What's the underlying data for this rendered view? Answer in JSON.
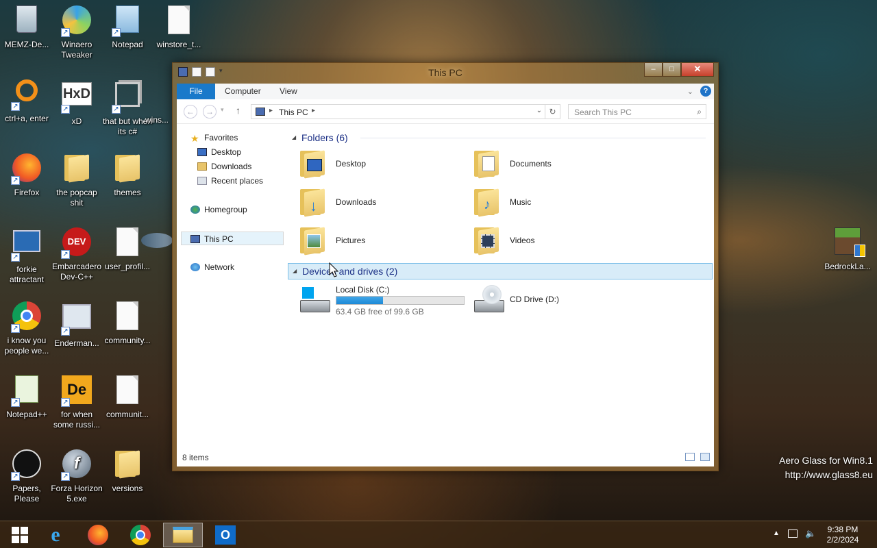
{
  "desktop": {
    "icons": [
      {
        "label": "MEMZ-De..."
      },
      {
        "label": "Winaero Tweaker"
      },
      {
        "label": "Notepad"
      },
      {
        "label": "winstore_t..."
      },
      {
        "label": "ctrl+a, enter"
      },
      {
        "label": "xD"
      },
      {
        "label": "that but when its c#"
      },
      {
        "label": "wins..."
      },
      {
        "label": "Firefox"
      },
      {
        "label": "the popcap shit"
      },
      {
        "label": "themes"
      },
      {
        "label": "forkie attractant"
      },
      {
        "label": "Embarcadero Dev-C++"
      },
      {
        "label": "user_profil..."
      },
      {
        "label": "i know you people we..."
      },
      {
        "label": "Enderman..."
      },
      {
        "label": "community..."
      },
      {
        "label": "Notepad++"
      },
      {
        "label": "for when some russi..."
      },
      {
        "label": "communit..."
      },
      {
        "label": "Papers, Please"
      },
      {
        "label": "Forza Horizon 5.exe"
      },
      {
        "label": "versions"
      },
      {
        "label": "BedrockLa..."
      }
    ],
    "watermark_line1": "Aero Glass for Win8.1",
    "watermark_line2": "http://www.glass8.eu"
  },
  "window": {
    "title": "This PC",
    "controls": {
      "minimize": "–",
      "maximize": "□",
      "close": "✕"
    },
    "ribbon": {
      "tabs": [
        "File",
        "Computer",
        "View"
      ],
      "help": "?"
    },
    "address": {
      "crumb": "This PC"
    },
    "search": {
      "placeholder": "Search This PC"
    },
    "nav": {
      "favorites": "Favorites",
      "desktop": "Desktop",
      "downloads": "Downloads",
      "recent": "Recent places",
      "homegroup": "Homegroup",
      "thispc": "This PC",
      "network": "Network"
    },
    "folders_header": "Folders (6)",
    "folders": [
      "Desktop",
      "Documents",
      "Downloads",
      "Music",
      "Pictures",
      "Videos"
    ],
    "devices_header": "Devices and drives (2)",
    "drives": [
      {
        "name": "Local Disk (C:)",
        "free_text": "63.4 GB free of 99.6 GB",
        "used_fraction": 0.363
      },
      {
        "name": "CD Drive (D:)"
      }
    ],
    "status": "8 items"
  },
  "taskbar": {
    "time": "9:38 PM",
    "date": "2/2/2024"
  },
  "colors": {
    "accent": "#1979ca",
    "drive_bar": "#1d89d6",
    "group_header": "#1e3287"
  }
}
